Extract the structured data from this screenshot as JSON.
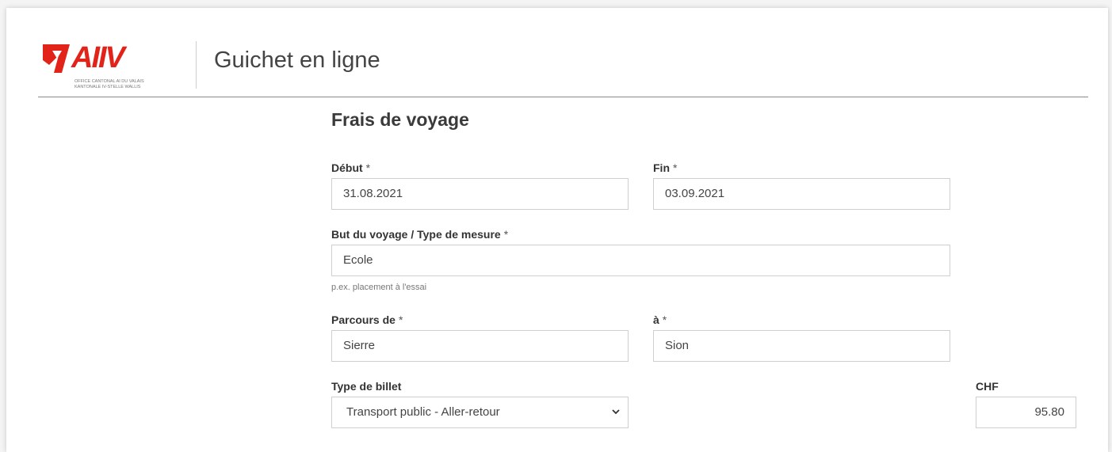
{
  "header": {
    "logo_text": "AIIV",
    "logo_subtitle_line1": "OFFICE CANTONAL AI DU VALAIS",
    "logo_subtitle_line2": "KANTONALE IV-STELLE WALLIS",
    "app_title": "Guichet en ligne"
  },
  "form": {
    "title": "Frais de voyage",
    "required_mark": "*",
    "debut": {
      "label": "Début",
      "value": "31.08.2021"
    },
    "fin": {
      "label": "Fin",
      "value": "03.09.2021"
    },
    "but": {
      "label": "But du voyage / Type de mesure",
      "value": "Ecole",
      "hint": "p.ex. placement à l'essai"
    },
    "parcours_de": {
      "label": "Parcours de",
      "value": "Sierre"
    },
    "parcours_a": {
      "label": "à",
      "value": "Sion"
    },
    "type_billet": {
      "label": "Type de billet",
      "value": "Transport public - Aller-retour"
    },
    "chf": {
      "label": "CHF",
      "value": "95.80"
    }
  },
  "colors": {
    "brand": "#e2231a",
    "border": "#cfcfcf",
    "rule": "#8a8a8a"
  }
}
